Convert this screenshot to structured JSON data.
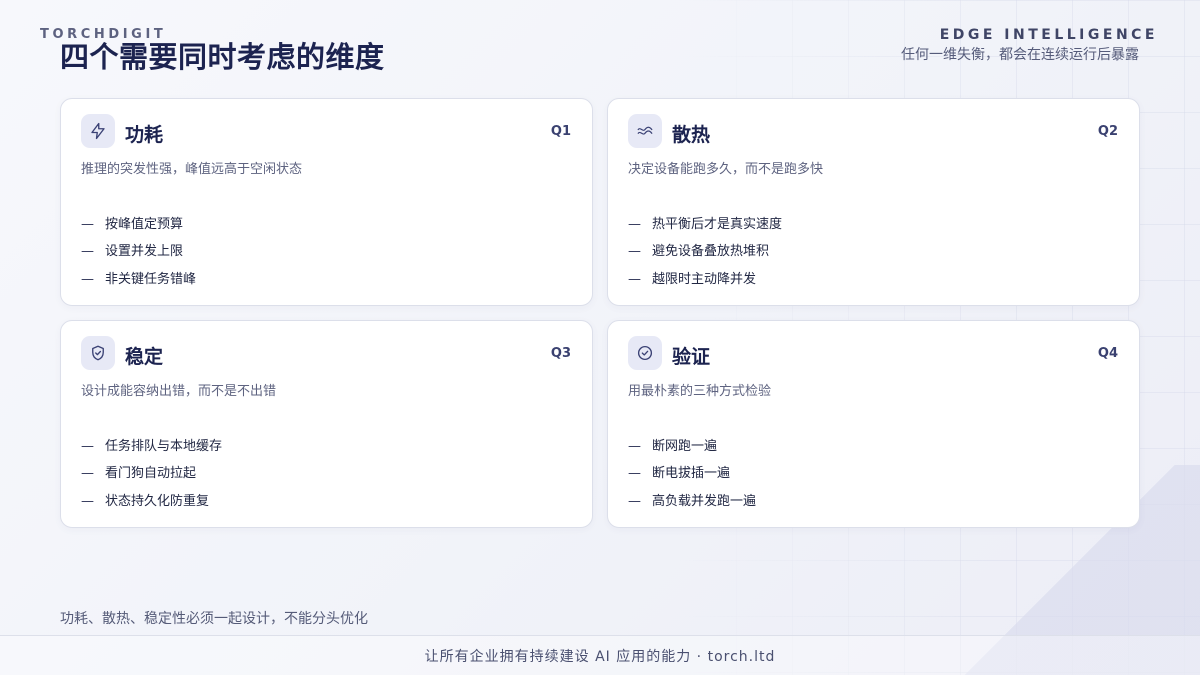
{
  "header": {
    "brand": "TORCHDIGIT",
    "title": "四个需要同时考虑的维度",
    "section_tag": "EDGE INTELLIGENCE",
    "section_sub": "任何一维失衡，都会在连续运行后暴露"
  },
  "cards": [
    {
      "icon": "lightning-icon",
      "title": "功耗",
      "code": "Q1",
      "desc": "推理的突发性强，峰值远高于空闲状态",
      "items": [
        "按峰值定预算",
        "设置并发上限",
        "非关键任务错峰"
      ]
    },
    {
      "icon": "wave-icon",
      "title": "散热",
      "code": "Q2",
      "desc": "决定设备能跑多久，而不是跑多快",
      "items": [
        "热平衡后才是真实速度",
        "避免设备叠放热堆积",
        "越限时主动降并发"
      ]
    },
    {
      "icon": "shield-check-icon",
      "title": "稳定",
      "code": "Q3",
      "desc": "设计成能容纳出错，而不是不出错",
      "items": [
        "任务排队与本地缓存",
        "看门狗自动拉起",
        "状态持久化防重复"
      ]
    },
    {
      "icon": "check-circle-icon",
      "title": "验证",
      "code": "Q4",
      "desc": "用最朴素的三种方式检验",
      "items": [
        "断网跑一遍",
        "断电拔插一遍",
        "高负载并发跑一遍"
      ]
    }
  ],
  "list_dash": "—",
  "footnote": "功耗、散热、稳定性必须一起设计，不能分头优化",
  "footer": "让所有企业拥有持续建设 AI 应用的能力 · torch.ltd",
  "colors": {
    "accent": "#1c2350",
    "icon_bg": "#e7e9f6",
    "card_border": "#dcdfea",
    "background": "#f3f4f9"
  }
}
